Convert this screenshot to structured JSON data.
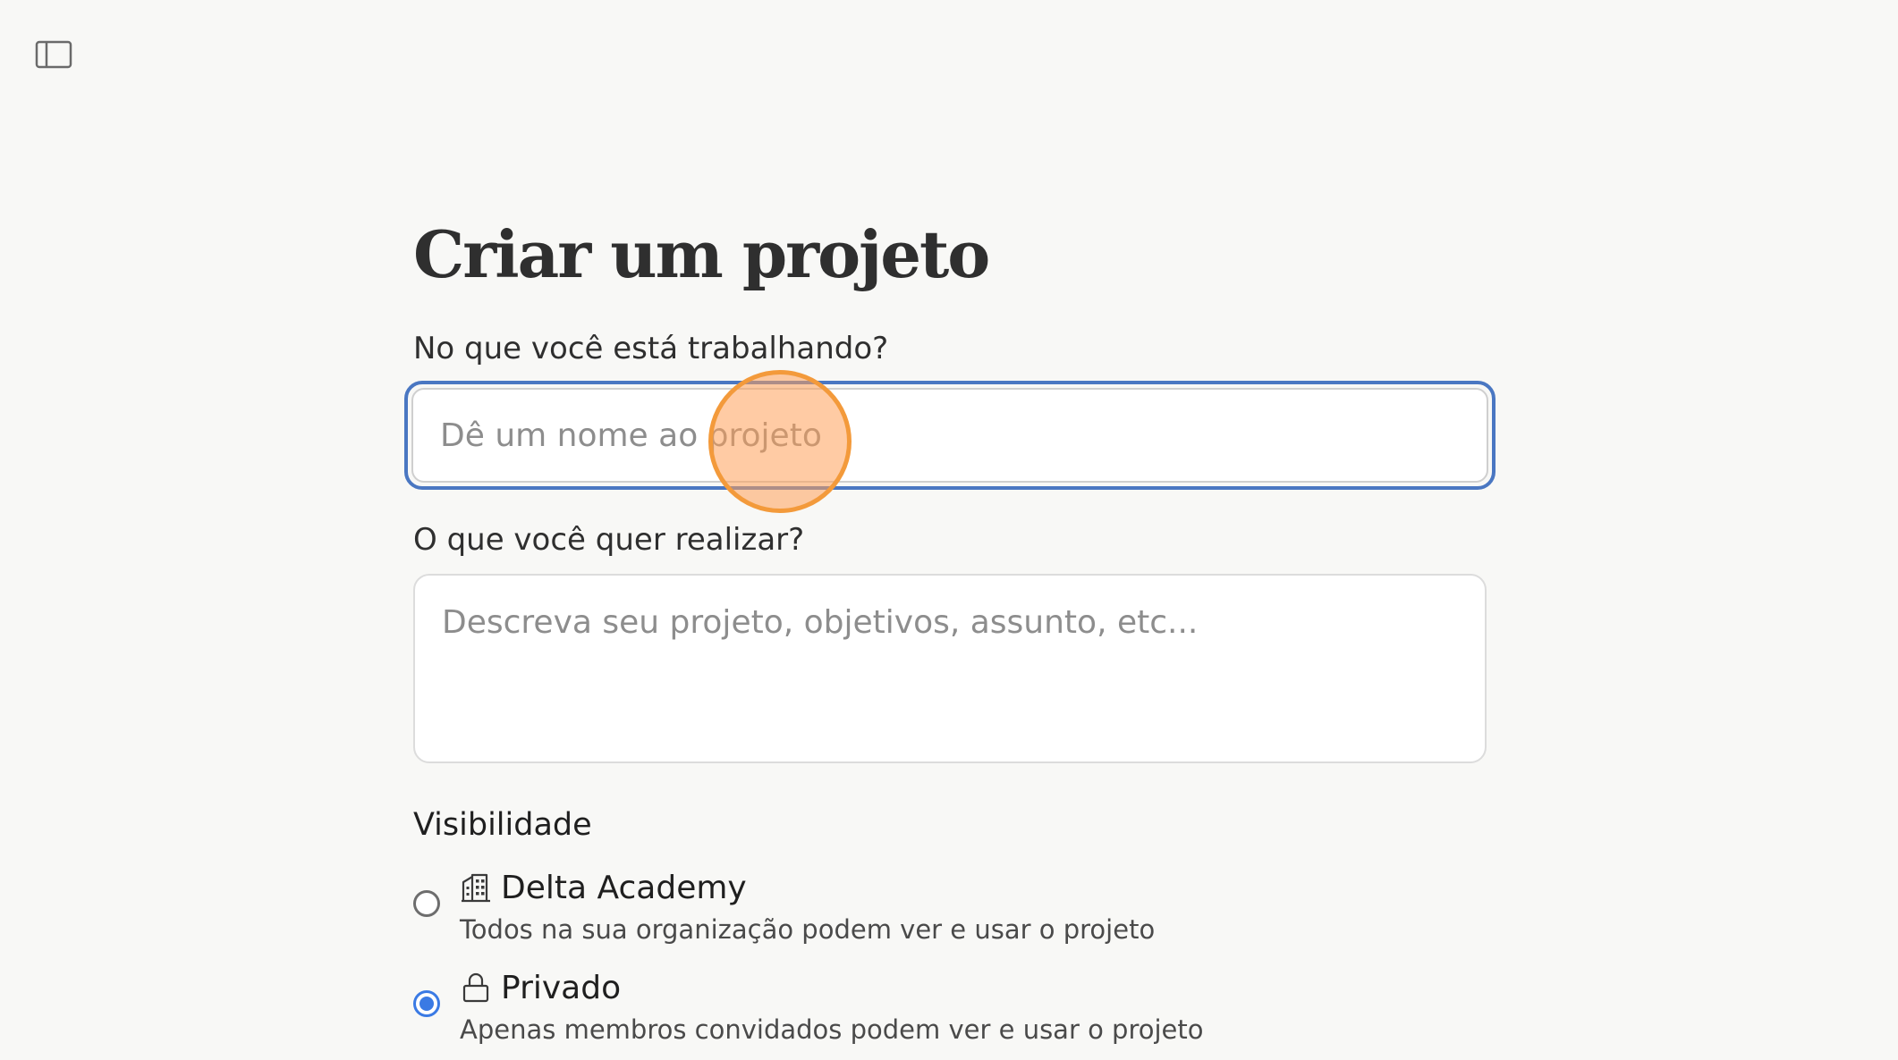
{
  "sidebar_toggle": {
    "icon": "sidebar-toggle-icon"
  },
  "form": {
    "title": "Criar um projeto",
    "name_label": "No que você está trabalhando?",
    "name_placeholder": "Dê um nome ao projeto",
    "description_label": "O que você quer realizar?",
    "description_placeholder": "Descreva seu projeto, objetivos, assunto, etc...",
    "visibility": {
      "title": "Visibilidade",
      "options": [
        {
          "name": "Delta Academy",
          "description": "Todos na sua organização podem ver e usar o projeto",
          "icon": "building-icon",
          "selected": false
        },
        {
          "name": "Privado",
          "description": "Apenas membros convidados podem ver e usar o projeto",
          "icon": "lock-icon",
          "selected": true
        }
      ]
    }
  },
  "colors": {
    "focus_ring": "#4a77c2",
    "radio_selected": "#3a7ae4",
    "click_marker": "#f39a3b"
  }
}
